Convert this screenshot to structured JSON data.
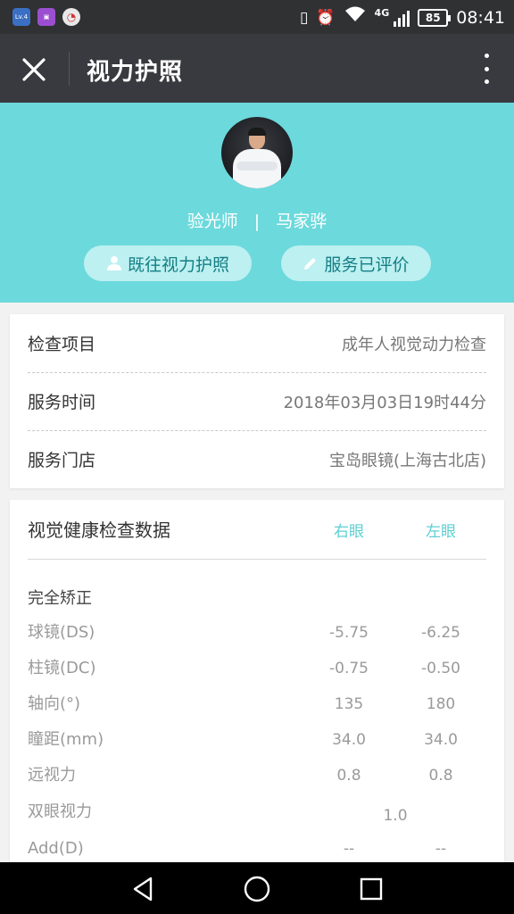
{
  "status_bar": {
    "app_icons": [
      "Lv.4",
      "image-app-icon",
      "clock-app-icon"
    ],
    "network": "4G",
    "battery": "85",
    "time": "08:41"
  },
  "header": {
    "title": "视力护照"
  },
  "profile": {
    "role": "验光师",
    "separator": "|",
    "name": "马家骅",
    "history_button": "既往视力护照",
    "review_button": "服务已评价"
  },
  "service": {
    "rows": [
      {
        "label": "检查项目",
        "value": "成年人视觉动力检查"
      },
      {
        "label": "服务时间",
        "value": "2018年03月03日19时44分"
      },
      {
        "label": "服务门店",
        "value": "宝岛眼镜(上海古北店)"
      }
    ]
  },
  "exam": {
    "title": "视觉健康检查数据",
    "right_eye": "右眼",
    "left_eye": "左眼",
    "section": "完全矫正",
    "rows": [
      {
        "label": "球镜(DS)",
        "right": "-5.75",
        "left": "-6.25"
      },
      {
        "label": "柱镜(DC)",
        "right": "-0.75",
        "left": "-0.50"
      },
      {
        "label": "轴向(°)",
        "right": "135",
        "left": "180"
      },
      {
        "label": "瞳距(mm)",
        "right": "34.0",
        "left": "34.0"
      },
      {
        "label": "远视力",
        "right": "0.8",
        "left": "0.8"
      }
    ],
    "binocular": {
      "label": "双眼视力",
      "value": "1.0"
    },
    "add": {
      "label": "Add(D)",
      "right": "--",
      "left": "--"
    }
  },
  "colors": {
    "accent": "#6cd9dc",
    "titlebar": "#393a3f",
    "pill_bg": "#bdf0f1",
    "pill_text": "#147f84"
  }
}
